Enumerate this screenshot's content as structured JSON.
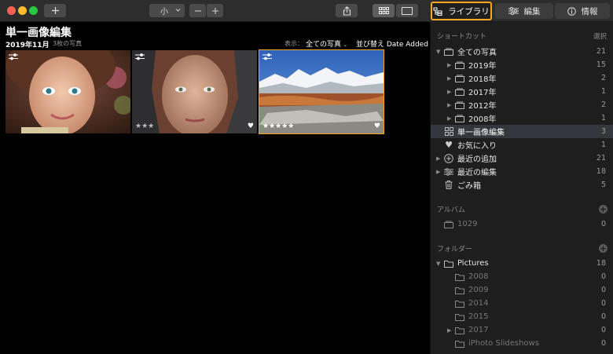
{
  "toolbar": {
    "size_select": "小",
    "tabs": [
      {
        "label": "ライブラリ",
        "active": true
      },
      {
        "label": "編集"
      },
      {
        "label": "情報"
      }
    ]
  },
  "album": {
    "title": "単一画像編集",
    "date": "2019年11月",
    "count": "3枚の写真",
    "filter_label": "表示：",
    "filter_value": "全ての写真",
    "sort_label": "並び替え Date Added"
  },
  "photos": [
    {
      "rating": 0,
      "favorite": false,
      "selected": false
    },
    {
      "rating": 3,
      "favorite": true,
      "selected": false
    },
    {
      "rating": 5,
      "favorite": true,
      "selected": true
    }
  ],
  "stars": {
    "three": "★★★",
    "five": "★★★★★",
    "heart": "♥"
  },
  "sidebar": {
    "shortcuts_title": "ショートカット",
    "select_label": "選択",
    "shortcuts": [
      {
        "label": "全ての写真",
        "count": "21",
        "icon": "photos-icon",
        "expanded": true
      },
      {
        "label": "2019年",
        "count": "15",
        "icon": "folder-icon",
        "child": true
      },
      {
        "label": "2018年",
        "count": "2",
        "icon": "folder-icon",
        "child": true
      },
      {
        "label": "2017年",
        "count": "1",
        "icon": "folder-icon",
        "child": true
      },
      {
        "label": "2012年",
        "count": "2",
        "icon": "folder-icon",
        "child": true
      },
      {
        "label": "2008年",
        "count": "1",
        "icon": "folder-icon",
        "child": true
      },
      {
        "label": "単一画像編集",
        "count": "3",
        "icon": "grid-icon",
        "selected": true
      },
      {
        "label": "お気に入り",
        "count": "1",
        "icon": "heart-icon"
      },
      {
        "label": "最近の追加",
        "count": "21",
        "icon": "plus-circle-icon"
      },
      {
        "label": "最近の編集",
        "count": "18",
        "icon": "sliders-icon"
      },
      {
        "label": "ごみ箱",
        "count": "5",
        "icon": "trash-icon"
      }
    ],
    "albums_title": "アルバム",
    "albums": [
      {
        "label": "1029",
        "count": "0"
      }
    ],
    "folders_title": "フォルダー",
    "folders": [
      {
        "label": "Pictures",
        "count": "18"
      },
      {
        "label": "2008",
        "count": "0"
      },
      {
        "label": "2009",
        "count": "0"
      },
      {
        "label": "2014",
        "count": "0"
      },
      {
        "label": "2015",
        "count": "0"
      },
      {
        "label": "2017",
        "count": "0"
      },
      {
        "label": "iPhoto Slideshows",
        "count": "0"
      }
    ]
  }
}
